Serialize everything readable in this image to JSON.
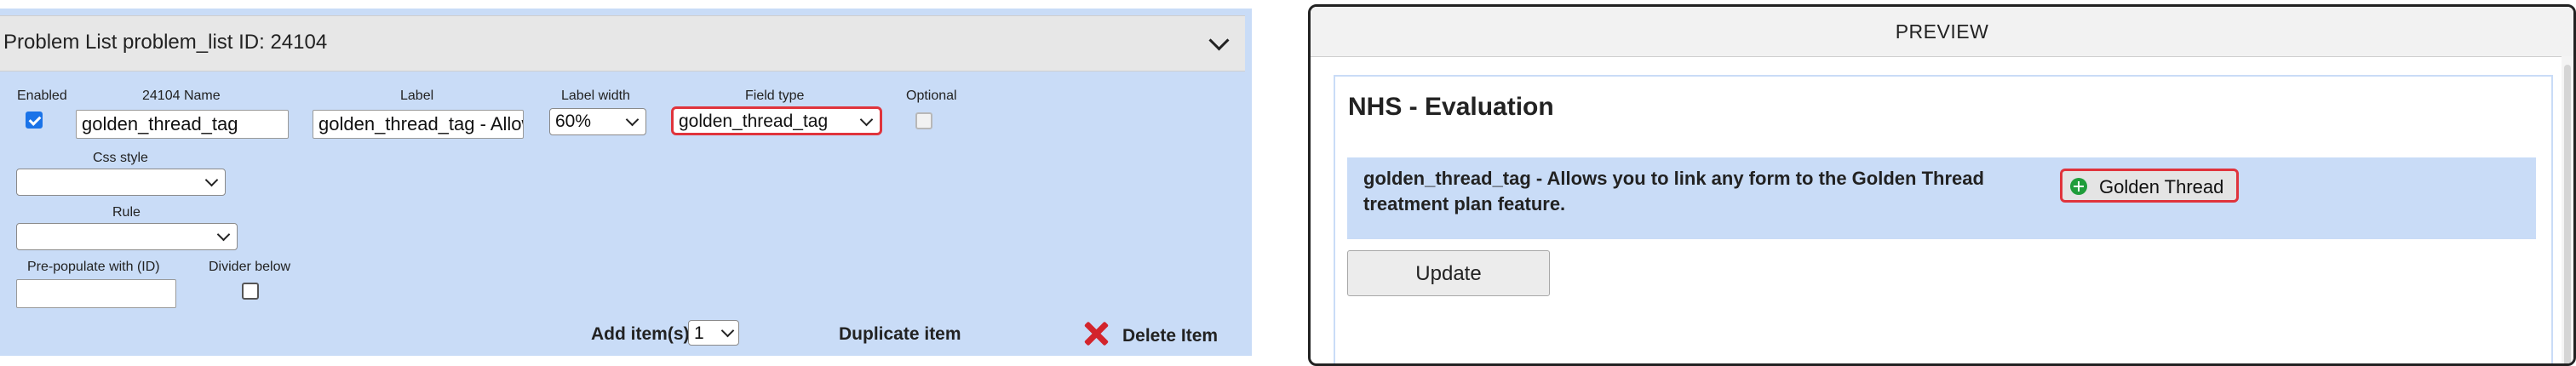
{
  "editor": {
    "title": "Problem List problem_list ID: 24104",
    "fields": {
      "enabled_label": "Enabled",
      "enabled_checked": true,
      "name_label": "24104 Name",
      "name_value": "golden_thread_tag",
      "label_label": "Label",
      "label_value": "golden_thread_tag - Allow",
      "label_width_label": "Label width",
      "label_width_value": "60%",
      "field_type_label": "Field type",
      "field_type_value": "golden_thread_tag",
      "optional_label": "Optional",
      "optional_checked": false,
      "css_style_label": "Css style",
      "css_style_value": "",
      "rule_label": "Rule",
      "rule_value": "",
      "prepopulate_label": "Pre-populate with (ID)",
      "prepopulate_value": "",
      "divider_label": "Divider below",
      "divider_checked": false
    },
    "footer": {
      "add_items_label": "Add item(s)",
      "add_items_value": "1",
      "duplicate_label": "Duplicate item",
      "delete_label": "Delete Item"
    },
    "colors": {
      "panel_background": "#c9dcf7",
      "highlight_border": "#e0343c",
      "delete_icon": "#d3242c"
    }
  },
  "preview": {
    "header": "PREVIEW",
    "form_title": "NHS - Evaluation",
    "field_text": "golden_thread_tag - Allows you to link any form to the Golden Thread treatment plan feature.",
    "golden_thread_button": "Golden Thread",
    "golden_thread_icon": "plus-circle-icon",
    "update_button": "Update"
  }
}
